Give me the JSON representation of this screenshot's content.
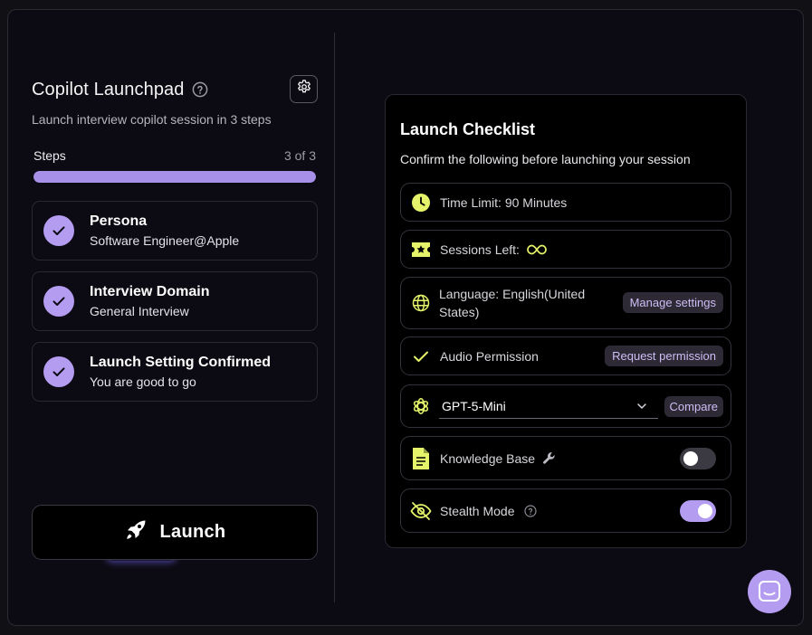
{
  "launchpad": {
    "title": "Copilot Launchpad",
    "subtitle": "Launch interview copilot session in 3 steps",
    "steps_label": "Steps",
    "steps_count": "3 of 3",
    "progress": 1.0,
    "steps": [
      {
        "title": "Persona",
        "subtitle": "Software Engineer@Apple"
      },
      {
        "title": "Interview Domain",
        "subtitle": "General Interview"
      },
      {
        "title": "Launch Setting Confirmed",
        "subtitle": "You are good to go"
      }
    ],
    "launch_label": "Launch"
  },
  "checklist": {
    "title": "Launch Checklist",
    "subtitle": "Confirm the following before launching your session",
    "time_limit": "Time Limit: 90 Minutes",
    "sessions_left": "Sessions Left:",
    "language": "Language: English(United States)",
    "manage_settings": "Manage settings",
    "audio_permission": "Audio Permission",
    "request_permission": "Request permission",
    "model": "GPT-5-Mini",
    "compare": "Compare",
    "knowledge_base": "Knowledge Base",
    "knowledge_base_enabled": false,
    "stealth_mode": "Stealth Mode",
    "stealth_mode_enabled": true
  },
  "colors": {
    "accent": "#b49df0",
    "icon_yellow": "#e4f36a",
    "pill_bg": "#2d2a35",
    "pill_text": "#cdbdf5"
  },
  "icons": [
    "help-icon",
    "gear-icon",
    "check-icon",
    "rocket-icon",
    "clock-icon",
    "ticket-icon",
    "infinity-icon",
    "globe-icon",
    "openai-icon",
    "chevron-down-icon",
    "document-icon",
    "wrench-icon",
    "eye-off-icon",
    "chat-icon"
  ]
}
